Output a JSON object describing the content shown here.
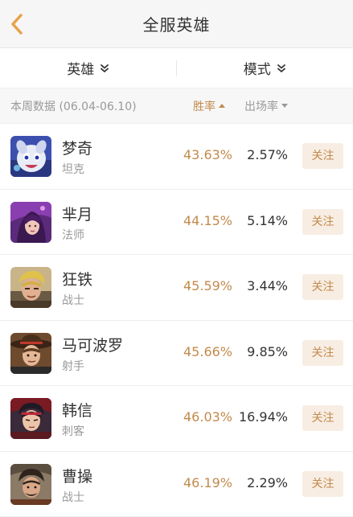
{
  "header": {
    "title": "全服英雄",
    "back_icon": "chevron-left-icon",
    "accent_color": "#e8a24a"
  },
  "filters": {
    "hero_label": "英雄",
    "mode_label": "模式",
    "dropdown_icon": "double-chevron-down-icon"
  },
  "columns": {
    "period": "本周数据 (06.04-06.10)",
    "win_rate_label": "胜率",
    "pick_rate_label": "出场率",
    "sort_active": "win_rate",
    "sort_direction": "ascending"
  },
  "colors": {
    "accent": "#c28a4c",
    "follow_bg": "#f8ede2",
    "muted": "#999999"
  },
  "heroes": [
    {
      "name": "梦奇",
      "role": "坦克",
      "win_rate": "43.63%",
      "pick_rate": "2.57%",
      "follow_label": "关注",
      "avatar": "mengqi-avatar"
    },
    {
      "name": "芈月",
      "role": "法师",
      "win_rate": "44.15%",
      "pick_rate": "5.14%",
      "follow_label": "关注",
      "avatar": "miyue-avatar"
    },
    {
      "name": "狂铁",
      "role": "战士",
      "win_rate": "45.59%",
      "pick_rate": "3.44%",
      "follow_label": "关注",
      "avatar": "kuangtie-avatar"
    },
    {
      "name": "马可波罗",
      "role": "射手",
      "win_rate": "45.66%",
      "pick_rate": "9.85%",
      "follow_label": "关注",
      "avatar": "makeboluo-avatar"
    },
    {
      "name": "韩信",
      "role": "刺客",
      "win_rate": "46.03%",
      "pick_rate": "16.94%",
      "follow_label": "关注",
      "avatar": "hanxin-avatar"
    },
    {
      "name": "曹操",
      "role": "战士",
      "win_rate": "46.19%",
      "pick_rate": "2.29%",
      "follow_label": "关注",
      "avatar": "caocao-avatar"
    }
  ]
}
